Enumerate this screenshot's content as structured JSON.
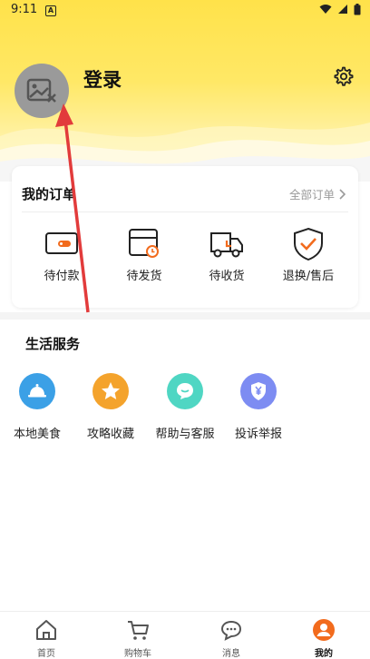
{
  "status_bar": {
    "time": "9:11",
    "notif_badge": "A"
  },
  "profile": {
    "login_label": "登录"
  },
  "orders": {
    "title": "我的订单",
    "all_label": "全部订单",
    "items": [
      {
        "label": "待付款",
        "icon": "wallet-icon"
      },
      {
        "label": "待发货",
        "icon": "package-clock-icon"
      },
      {
        "label": "待收货",
        "icon": "truck-icon"
      },
      {
        "label": "退换/售后",
        "icon": "shield-check-icon"
      }
    ]
  },
  "life_services": {
    "title": "生活服务",
    "items": [
      {
        "label": "本地美食",
        "icon": "food-cloche-icon",
        "color": "#3ba0e6"
      },
      {
        "label": "攻略收藏",
        "icon": "star-icon",
        "color": "#f4a32c"
      },
      {
        "label": "帮助与客服",
        "icon": "chat-bubble-icon",
        "color": "#4fd6c3"
      },
      {
        "label": "投诉举报",
        "icon": "shield-yen-icon",
        "color": "#7d8cf2"
      }
    ]
  },
  "tabbar": {
    "items": [
      {
        "label": "首页",
        "icon": "home-icon"
      },
      {
        "label": "购物车",
        "icon": "cart-icon"
      },
      {
        "label": "消息",
        "icon": "message-icon"
      },
      {
        "label": "我的",
        "icon": "profile-icon",
        "active": true
      }
    ]
  },
  "colors": {
    "header_yellow": "#ffe24a",
    "accent_orange": "#f26b1d",
    "annotation_red": "#e23b3b"
  }
}
